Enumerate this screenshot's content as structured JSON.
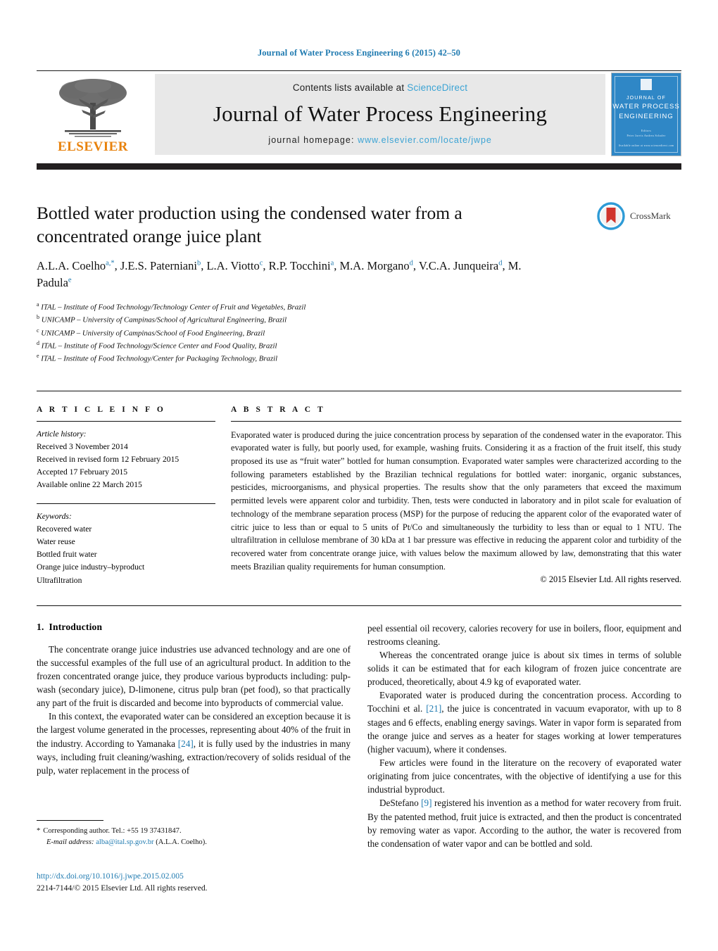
{
  "running_head": "Journal of Water Process Engineering 6 (2015) 42–50",
  "masthead": {
    "publisher_name": "ELSEVIER",
    "contents_prefix": "Contents lists available at ",
    "contents_link": "ScienceDirect",
    "journal_name": "Journal of Water Process Engineering",
    "homepage_prefix": "journal homepage: ",
    "homepage_url": "www.elsevier.com/locate/jwpe",
    "cover": {
      "line1": "JOURNAL OF",
      "line2": "WATER PROCESS",
      "line3": "ENGINEERING",
      "sub1": "Editors",
      "sub2": "Peter Jarvis   Andrea Schafer",
      "foot": "Available online at www.sciencedirect.com"
    }
  },
  "article": {
    "title": "Bottled water production using the condensed water from a concentrated orange juice plant",
    "authors": [
      {
        "name": "A.L.A. Coelho",
        "sup": "a,*"
      },
      {
        "name": "J.E.S. Paterniani",
        "sup": "b"
      },
      {
        "name": "L.A. Viotto",
        "sup": "c"
      },
      {
        "name": "R.P. Tocchini",
        "sup": "a"
      },
      {
        "name": "M.A. Morgano",
        "sup": "d"
      },
      {
        "name": "V.C.A. Junqueira",
        "sup": "d"
      },
      {
        "name": "M. Padula",
        "sup": "e"
      }
    ],
    "affiliations": [
      {
        "sup": "a",
        "text": "ITAL – Institute of Food Technology/Technology Center of Fruit and Vegetables, Brazil"
      },
      {
        "sup": "b",
        "text": "UNICAMP – University of Campinas/School of Agricultural Engineering, Brazil"
      },
      {
        "sup": "c",
        "text": "UNICAMP – University of Campinas/School of Food Engineering, Brazil"
      },
      {
        "sup": "d",
        "text": "ITAL – Institute of Food Technology/Science Center and Food Quality, Brazil"
      },
      {
        "sup": "e",
        "text": "ITAL – Institute of Food Technology/Center for Packaging Technology, Brazil"
      }
    ],
    "crossmark_label": "CrossMark"
  },
  "article_info": {
    "heading": "A R T I C L E   I N F O",
    "history_label": "Article history:",
    "history": [
      "Received 3 November 2014",
      "Received in revised form 12 February 2015",
      "Accepted 17 February 2015",
      "Available online 22 March 2015"
    ],
    "keywords_label": "Keywords:",
    "keywords": [
      "Recovered water",
      "Water reuse",
      "Bottled fruit water",
      "Orange juice industry–byproduct",
      "Ultrafiltration"
    ]
  },
  "abstract": {
    "heading": "A B S T R A C T",
    "text": "Evaporated water is produced during the juice concentration process by separation of the condensed water in the evaporator. This evaporated water is fully, but poorly used, for example, washing fruits. Considering it as a fraction of the fruit itself, this study proposed its use as “fruit water” bottled for human consumption. Evaporated water samples were characterized according to the following parameters established by the Brazilian technical regulations for bottled water: inorganic, organic substances, pesticides, microorganisms, and physical properties. The results show that the only parameters that exceed the maximum permitted levels were apparent color and turbidity. Then, tests were conducted in laboratory and in pilot scale for evaluation of technology of the membrane separation process (MSP) for the purpose of reducing the apparent color of the evaporated water of citric juice to less than or equal to 5 units of Pt/Co and simultaneously the turbidity to less than or equal to 1 NTU. The ultrafiltration in cellulose membrane of 30 kDa at 1 bar pressure was effective in reducing the apparent color and turbidity of the recovered water from concentrate orange juice, with values  below the maximum allowed by law, demonstrating that this water meets Brazilian quality requirements for human consumption.",
    "copyright": "© 2015 Elsevier Ltd. All rights reserved."
  },
  "introduction": {
    "number": "1.",
    "title": "Introduction",
    "left_paragraphs": [
      "The concentrate orange juice industries use advanced technology and are one of the successful examples of the full use of an agricultural product. In addition to the frozen concentrated orange juice, they produce various byproducts including: pulp-wash (secondary juice), D-limonene, citrus pulp bran (pet food), so that practically any part of the fruit is discarded and become into byproducts of commercial value."
    ],
    "left_para2_pre": "In this context, the evaporated water can be considered an exception because it is the largest volume generated in the processes, representing about 40% of the fruit in the industry. According to Yamanaka ",
    "left_para2_ref": "[24]",
    "left_para2_post": ", it is fully used by the industries in many ways, including fruit cleaning/washing, extraction/recovery of solids residual of the pulp, water replacement in the process of",
    "right_para1": "peel essential oil recovery, calories recovery for use in boilers, floor, equipment and restrooms cleaning.",
    "right_para2": "Whereas the concentrated orange juice is about six times in terms of soluble solids it can be estimated that for each kilogram of frozen juice concentrate are produced, theoretically, about 4.9 kg of evaporated water.",
    "right_para3_pre": "Evaporated water is produced during the concentration process. According to Tocchini et al. ",
    "right_para3_ref": "[21]",
    "right_para3_post": ", the juice is concentrated in vacuum evaporator, with up to 8 stages and 6 effects, enabling energy savings. Water in vapor form is separated from the orange juice and serves as a heater for stages working at lower temperatures (higher vacuum), where it condenses.",
    "right_para4": "Few articles were found in the literature on the recovery of evaporated water originating from juice concentrates, with the objective of identifying a use for this industrial byproduct.",
    "right_para5_pre": "DeStefano ",
    "right_para5_ref": "[9]",
    "right_para5_post": " registered his invention as a method for water recovery from fruit. By the patented method, fruit juice is extracted, and then the product is concentrated by removing water as vapor. According to the author, the water is recovered from the condensation of water vapor and can be bottled and sold."
  },
  "footnote": {
    "star": "*",
    "corresponding": "Corresponding author. Tel.: +55 19 37431847.",
    "email_label": "E-mail address:",
    "email": "alba@ital.sp.gov.br",
    "email_owner": "(A.L.A. Coelho)."
  },
  "footer": {
    "doi": "http://dx.doi.org/10.1016/j.jwpe.2015.02.005",
    "issn_line": "2214-7144/© 2015 Elsevier Ltd. All rights reserved."
  },
  "colors": {
    "link_blue": "#1f7ab0",
    "sciencedirect_blue": "#3ba3d4",
    "elsevier_orange": "#E8820C",
    "cover_blue": "#2f87c6",
    "band_black": "#231f20"
  }
}
